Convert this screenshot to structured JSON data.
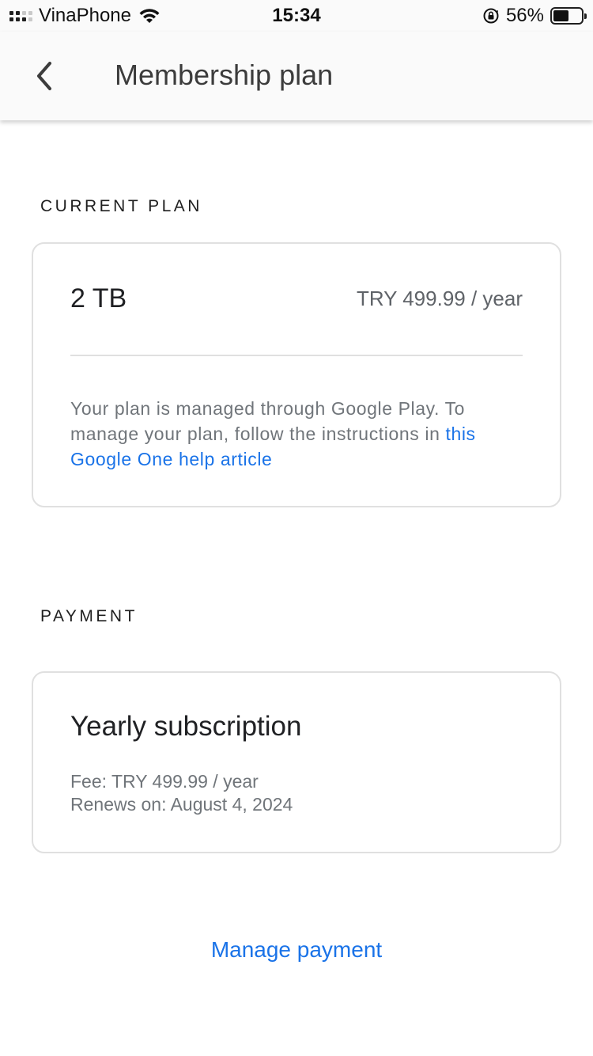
{
  "status_bar": {
    "carrier": "VinaPhone",
    "time": "15:34",
    "battery_percent": "56%",
    "battery_level": 0.56,
    "icons": [
      "signal-icon",
      "wifi-icon",
      "rotation-lock-icon",
      "battery-icon"
    ]
  },
  "app_bar": {
    "title": "Membership plan",
    "back_icon": "chevron-left-icon"
  },
  "current_plan": {
    "section_label": "CURRENT PLAN",
    "size": "2 TB",
    "price": "TRY 499.99 / year",
    "note_text": "Your plan is managed through Google Play. To manage your plan, follow the instructions in ",
    "help_link": "this Google One help article"
  },
  "payment": {
    "section_label": "PAYMENT",
    "title": "Yearly subscription",
    "fee": "Fee: TRY 499.99 / year",
    "renews": "Renews on: August 4, 2024"
  },
  "actions": {
    "manage_payment": "Manage payment"
  },
  "colors": {
    "link": "#1a73e8",
    "secondary_text": "#70757a",
    "border": "#e0e0e0"
  }
}
